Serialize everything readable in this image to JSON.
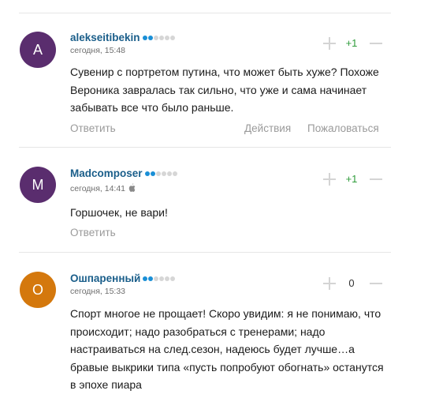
{
  "actions": {
    "reply": "Ответить",
    "actions": "Действия",
    "report": "Пожаловаться"
  },
  "comments": [
    {
      "avatar_letter": "A",
      "avatar_color": "#5a2d6e",
      "author": "alekseitibekin",
      "rating_dots_filled": 2,
      "rating_dots_total": 6,
      "date": "сегодня, 15:48",
      "score": "+1",
      "text": "Сувенир с портретом путина, что может быть хуже? Похоже Вероника завралась так сильно, что уже и сама начинает забывать все что было раньше."
    },
    {
      "avatar_letter": "M",
      "avatar_color": "#5a2d6e",
      "author": "Madcomposer",
      "rating_dots_filled": 2,
      "rating_dots_total": 6,
      "date": "сегодня, 14:41",
      "device_icon": "apple-icon",
      "score": "+1",
      "text": "Горшочек, не вари!"
    },
    {
      "avatar_letter": "О",
      "avatar_color": "#d4780d",
      "author": "Ошпаренный",
      "rating_dots_filled": 2,
      "rating_dots_total": 6,
      "date": "сегодня, 15:33",
      "score": "0",
      "text": "Спорт многое не прощает! Скоро увидим: я не понимаю, что происходит; надо разобраться с тренерами; надо настраиваться на след.сезон, надеюсь будет лучше…а бравые выкрики типа «пусть попробуют обогнать» останутся в эпохе пиара"
    }
  ]
}
